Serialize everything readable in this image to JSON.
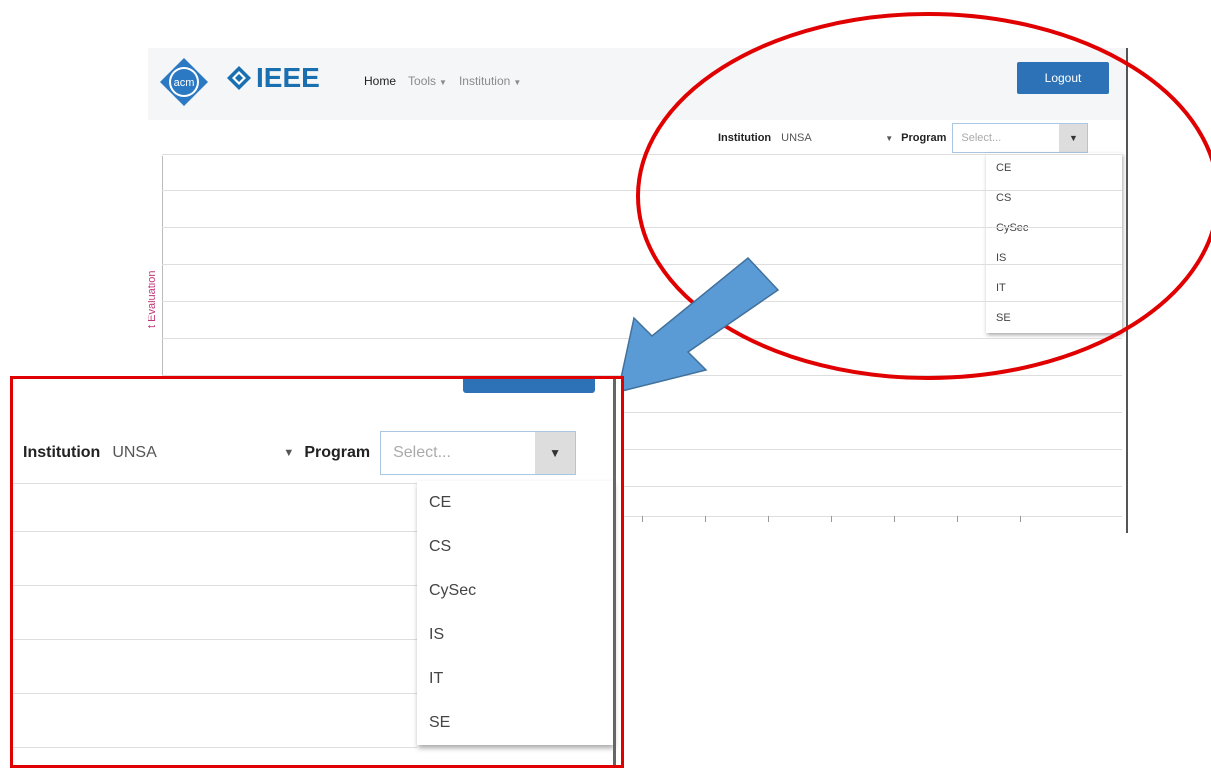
{
  "nav": {
    "acm": "acm",
    "ieee": "IEEE",
    "home": "Home",
    "tools": "Tools",
    "institution": "Institution",
    "logout": "Logout"
  },
  "filters": {
    "institution_label": "Institution",
    "institution_value": "UNSA",
    "program_label": "Program",
    "program_placeholder": "Select..."
  },
  "program_options": [
    "CE",
    "CS",
    "CySec",
    "IS",
    "IT",
    "SE"
  ],
  "chart": {
    "ylabel": "t Evaluation"
  },
  "colors": {
    "accent": "#2d72b6",
    "highlight_box": "#e00000",
    "ellipse": "#e00000",
    "arrow": "#5b9bd5",
    "ieee_blue": "#1a6fb0"
  },
  "icons": {
    "caret": "caret-down-icon"
  }
}
